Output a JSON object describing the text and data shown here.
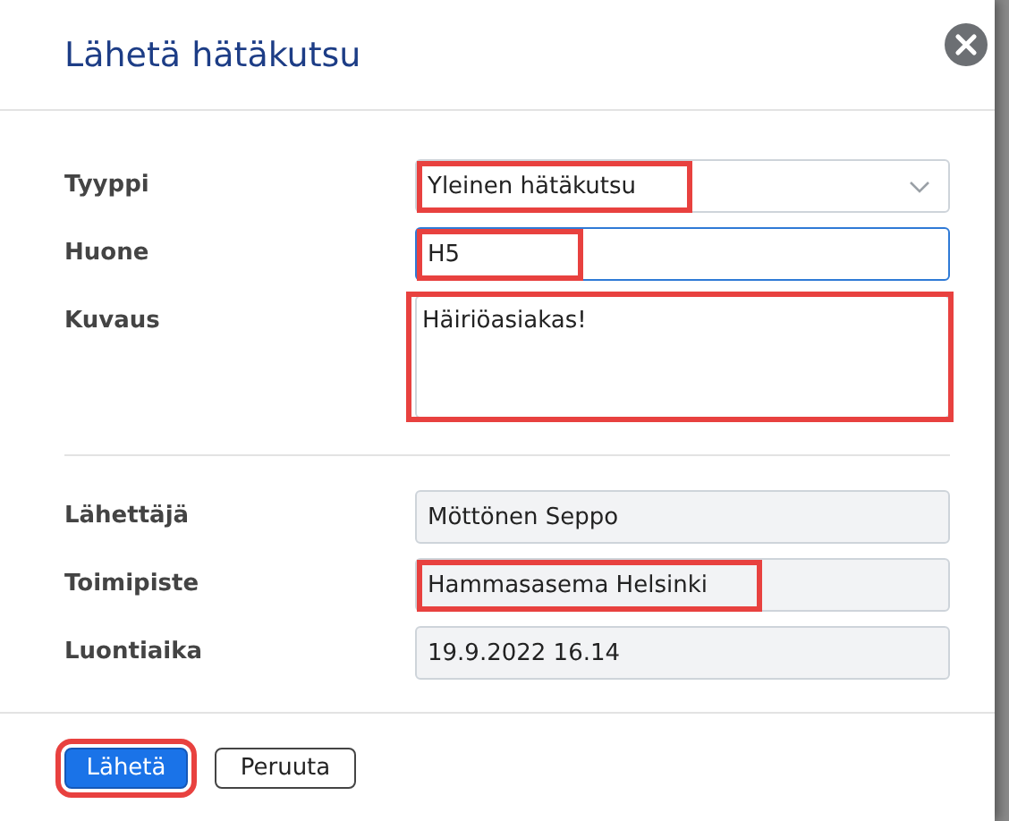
{
  "dialog": {
    "title": "Lähetä hätäkutsu"
  },
  "fields": [
    {
      "label": "Tyyppi",
      "value": "Yleinen hätäkutsu",
      "kind": "select",
      "readonly": false,
      "focused": false,
      "highlighted": true
    },
    {
      "label": "Huone",
      "value": "H5",
      "kind": "input",
      "readonly": false,
      "focused": true,
      "highlighted": true
    },
    {
      "label": "Kuvaus",
      "value": "Häiriöasiakas!",
      "kind": "textarea",
      "readonly": false,
      "focused": false,
      "highlighted": true
    },
    {
      "label": "Lähettäjä",
      "value": "Möttönen Seppo",
      "kind": "input",
      "readonly": true,
      "focused": false,
      "highlighted": false
    },
    {
      "label": "Toimipiste",
      "value": "Hammasasema Helsinki",
      "kind": "input",
      "readonly": true,
      "focused": false,
      "highlighted": true
    },
    {
      "label": "Luontiaika",
      "value": "19.9.2022 16.14",
      "kind": "input",
      "readonly": true,
      "focused": false,
      "highlighted": false
    }
  ],
  "buttons": [
    {
      "label": "Lähetä",
      "kind": "primary",
      "highlighted": true
    },
    {
      "label": "Peruuta",
      "kind": "secondary",
      "highlighted": false
    }
  ]
}
